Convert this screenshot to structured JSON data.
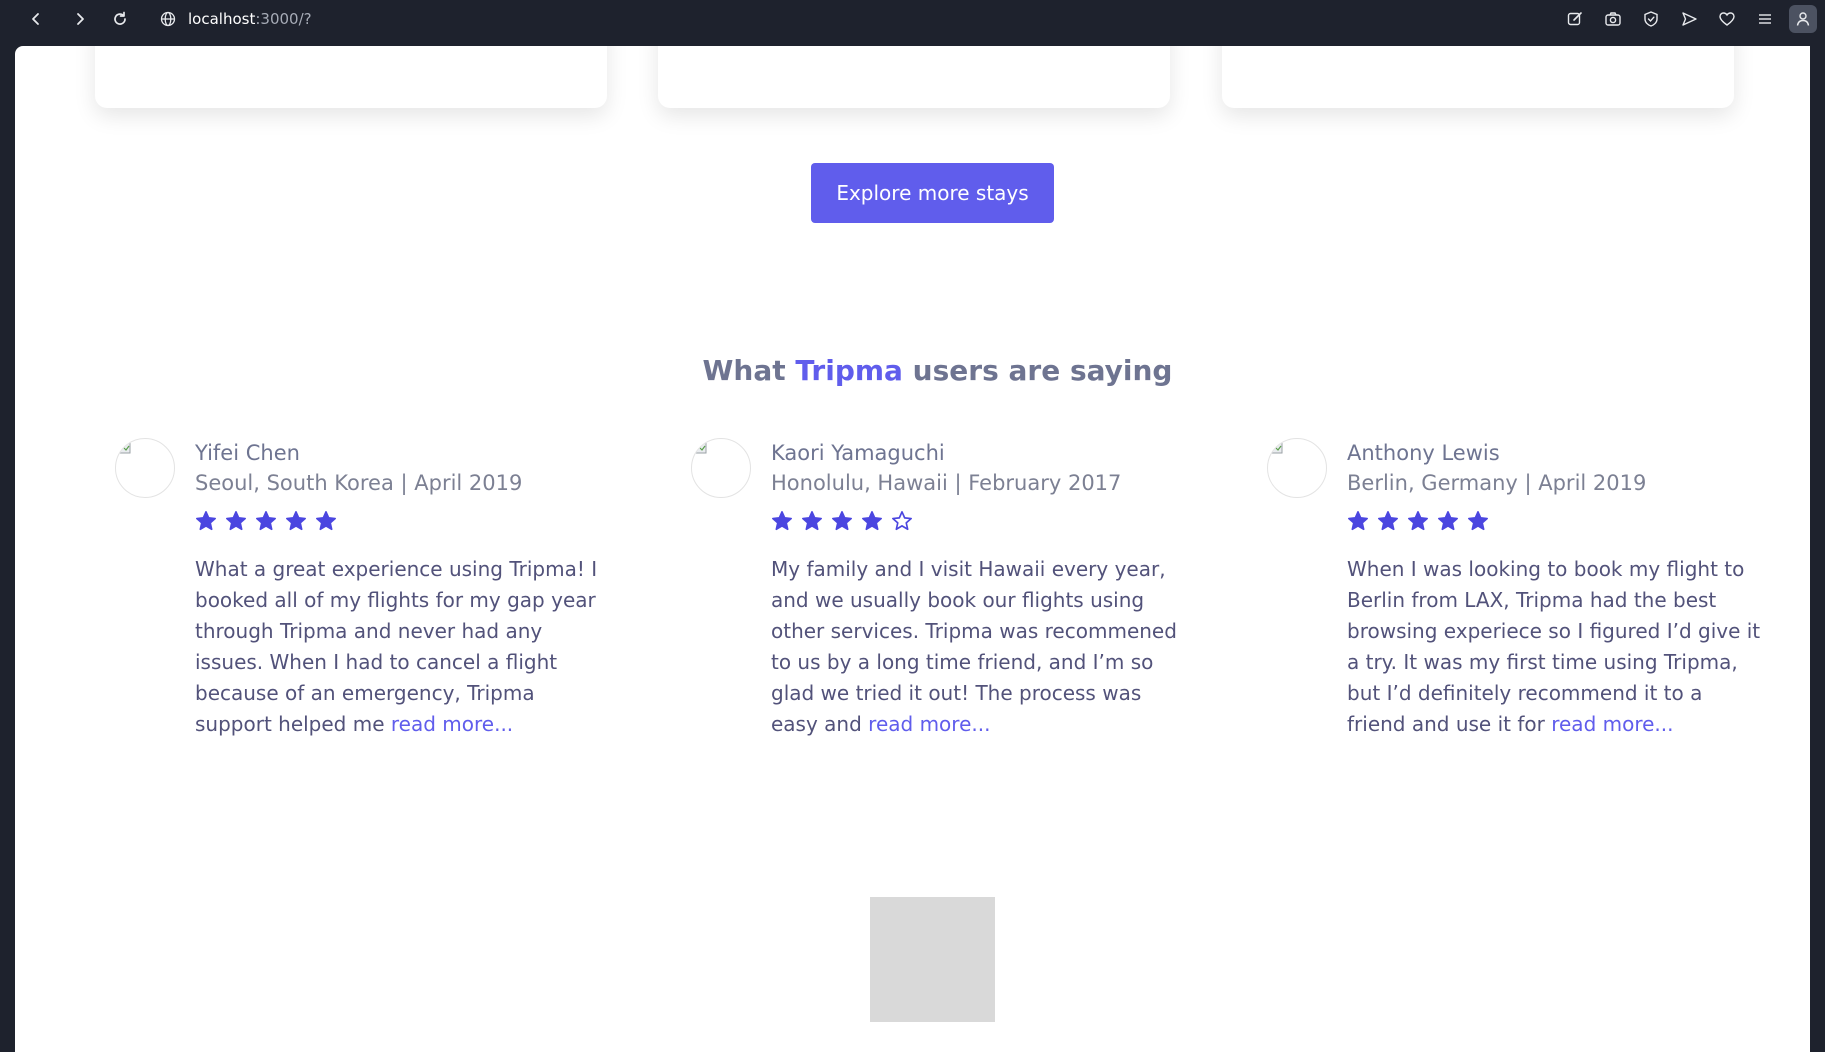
{
  "browser": {
    "url_host": "localhost",
    "url_path": ":3000/?"
  },
  "page": {
    "explore_button": "Explore more stays",
    "section_title": {
      "prefix": "What ",
      "brand": "Tripma",
      "suffix": " users are saying"
    },
    "reviews": [
      {
        "name": "Yifei Chen",
        "location": "Seoul, South Korea",
        "date": "April 2019",
        "meta": "Seoul, South Korea | April 2019",
        "rating": 5,
        "text": "What a great experience using Tripma! I booked all of my flights for my gap year through Tripma and never had any issues. When I had to cancel a flight because of an emergency, Tripma support helped me ",
        "read_more": "read more..."
      },
      {
        "name": "Kaori Yamaguchi",
        "location": "Honolulu, Hawaii",
        "date": "February 2017",
        "meta": "Honolulu, Hawaii | February 2017",
        "rating": 4,
        "text": "My family and I visit Hawaii every year, and we usually book our flights using other services. Tripma was recommened to us by a long time friend, and I’m so glad we tried it out! The process was easy and ",
        "read_more": "read more..."
      },
      {
        "name": "Anthony Lewis",
        "location": "Berlin, Germany",
        "date": "April 2019",
        "meta": "Berlin, Germany | April 2019",
        "rating": 5,
        "text": "When I was looking to book my flight to Berlin from LAX, Tripma had the best browsing experiece so I figured I’d give it a try. It was my first time using Tripma, but I’d definitely recommend it to a friend and use it for ",
        "read_more": "read more..."
      }
    ]
  },
  "colors": {
    "brand": "#605dec",
    "star": "#4b46e0",
    "heading": "#6e7491"
  },
  "icons": {
    "toolbar": [
      "edit-icon",
      "camera-icon",
      "shield-icon",
      "send-icon",
      "heart-icon",
      "menu-icon",
      "profile-icon"
    ]
  }
}
